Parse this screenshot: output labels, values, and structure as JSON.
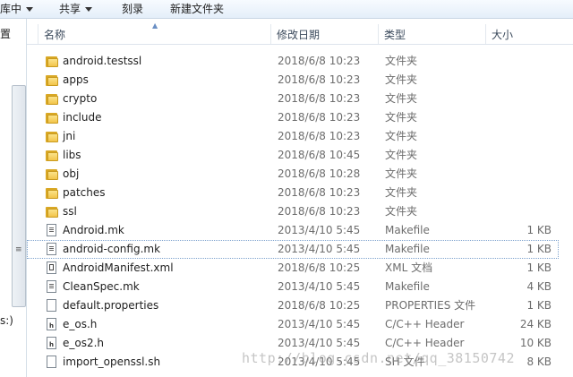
{
  "toolbar": {
    "organize": "库中",
    "share": "共享",
    "burn": "刻录",
    "new_folder": "新建文件夹"
  },
  "leftpane": {
    "top_text": "置",
    "bottom_text": "s:)"
  },
  "columns": {
    "name": "名称",
    "date": "修改日期",
    "type": "类型",
    "size": "大小"
  },
  "files": [
    {
      "name": "android.testssl",
      "date": "2018/6/8 10:23",
      "type": "文件夹",
      "size": "",
      "icon": "folder-icon"
    },
    {
      "name": "apps",
      "date": "2018/6/8 10:23",
      "type": "文件夹",
      "size": "",
      "icon": "folder-icon"
    },
    {
      "name": "crypto",
      "date": "2018/6/8 10:23",
      "type": "文件夹",
      "size": "",
      "icon": "folder-icon"
    },
    {
      "name": "include",
      "date": "2018/6/8 10:23",
      "type": "文件夹",
      "size": "",
      "icon": "folder-icon"
    },
    {
      "name": "jni",
      "date": "2018/6/8 10:23",
      "type": "文件夹",
      "size": "",
      "icon": "folder-icon"
    },
    {
      "name": "libs",
      "date": "2018/6/8 10:45",
      "type": "文件夹",
      "size": "",
      "icon": "folder-icon"
    },
    {
      "name": "obj",
      "date": "2018/6/8 10:28",
      "type": "文件夹",
      "size": "",
      "icon": "folder-icon"
    },
    {
      "name": "patches",
      "date": "2018/6/8 10:23",
      "type": "文件夹",
      "size": "",
      "icon": "folder-icon"
    },
    {
      "name": "ssl",
      "date": "2018/6/8 10:23",
      "type": "文件夹",
      "size": "",
      "icon": "folder-icon"
    },
    {
      "name": "Android.mk",
      "date": "2013/4/10 5:45",
      "type": "Makefile",
      "size": "1 KB",
      "icon": "makefile-icon"
    },
    {
      "name": "android-config.mk",
      "date": "2013/4/10 5:45",
      "type": "Makefile",
      "size": "1 KB",
      "icon": "makefile-icon",
      "selected": true
    },
    {
      "name": "AndroidManifest.xml",
      "date": "2018/6/8 10:25",
      "type": "XML 文档",
      "size": "1 KB",
      "icon": "xml-file-icon"
    },
    {
      "name": "CleanSpec.mk",
      "date": "2013/4/10 5:45",
      "type": "Makefile",
      "size": "4 KB",
      "icon": "makefile-icon"
    },
    {
      "name": "default.properties",
      "date": "2018/6/8 10:25",
      "type": "PROPERTIES 文件",
      "size": "1 KB",
      "icon": "blank-file-icon"
    },
    {
      "name": "e_os.h",
      "date": "2013/4/10 5:45",
      "type": "C/C++ Header",
      "size": "24 KB",
      "icon": "header-file-icon"
    },
    {
      "name": "e_os2.h",
      "date": "2013/4/10 5:45",
      "type": "C/C++ Header",
      "size": "10 KB",
      "icon": "header-file-icon"
    },
    {
      "name": "import_openssl.sh",
      "date": "2013/4/10 5:45",
      "type": "SH 文件",
      "size": "8 KB",
      "icon": "blank-file-icon"
    }
  ],
  "watermark": "http://blog.csdn.net/qq_38150742"
}
